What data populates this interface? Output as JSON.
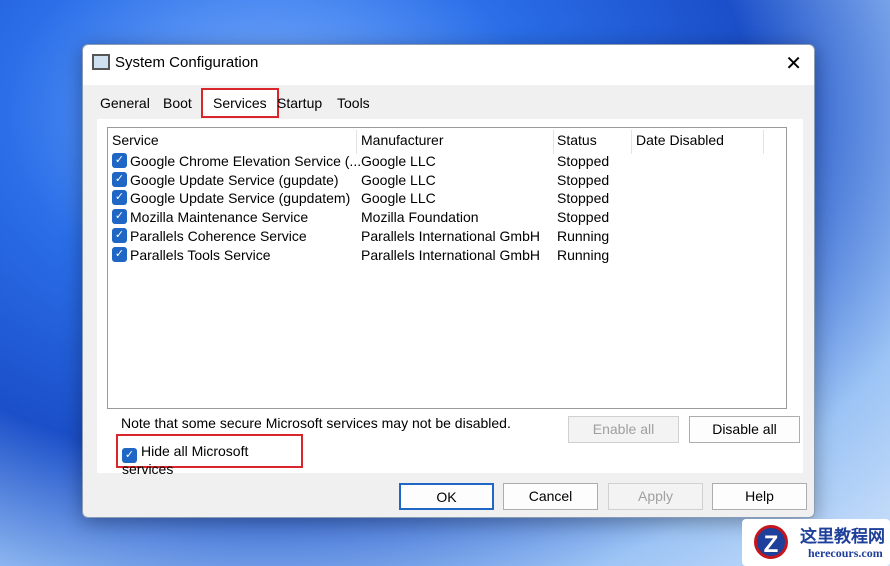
{
  "window": {
    "title": "System Configuration",
    "close": "✕"
  },
  "tabs": [
    "General",
    "Boot",
    "Services",
    "Startup",
    "Tools"
  ],
  "columns": [
    "Service",
    "Manufacturer",
    "Status",
    "Date Disabled"
  ],
  "rows": [
    {
      "service": "Google Chrome Elevation Service (...",
      "manufacturer": "Google LLC",
      "status": "Stopped",
      "date": ""
    },
    {
      "service": "Google Update Service (gupdate)",
      "manufacturer": "Google LLC",
      "status": "Stopped",
      "date": ""
    },
    {
      "service": "Google Update Service (gupdatem)",
      "manufacturer": "Google LLC",
      "status": "Stopped",
      "date": ""
    },
    {
      "service": "Mozilla Maintenance Service",
      "manufacturer": "Mozilla Foundation",
      "status": "Stopped",
      "date": ""
    },
    {
      "service": "Parallels Coherence Service",
      "manufacturer": "Parallels International GmbH",
      "status": "Running",
      "date": ""
    },
    {
      "service": "Parallels Tools Service",
      "manufacturer": "Parallels International GmbH",
      "status": "Running",
      "date": ""
    }
  ],
  "note": "Note that some secure Microsoft services may not be disabled.",
  "enable_all": "Enable all",
  "disable_all": "Disable all",
  "hide_ms": "Hide all Microsoft services",
  "buttons": {
    "ok": "OK",
    "cancel": "Cancel",
    "apply": "Apply",
    "help": "Help"
  },
  "watermark": {
    "cn": "这里教程网",
    "en": "herecours.com",
    "logo": "Z"
  }
}
